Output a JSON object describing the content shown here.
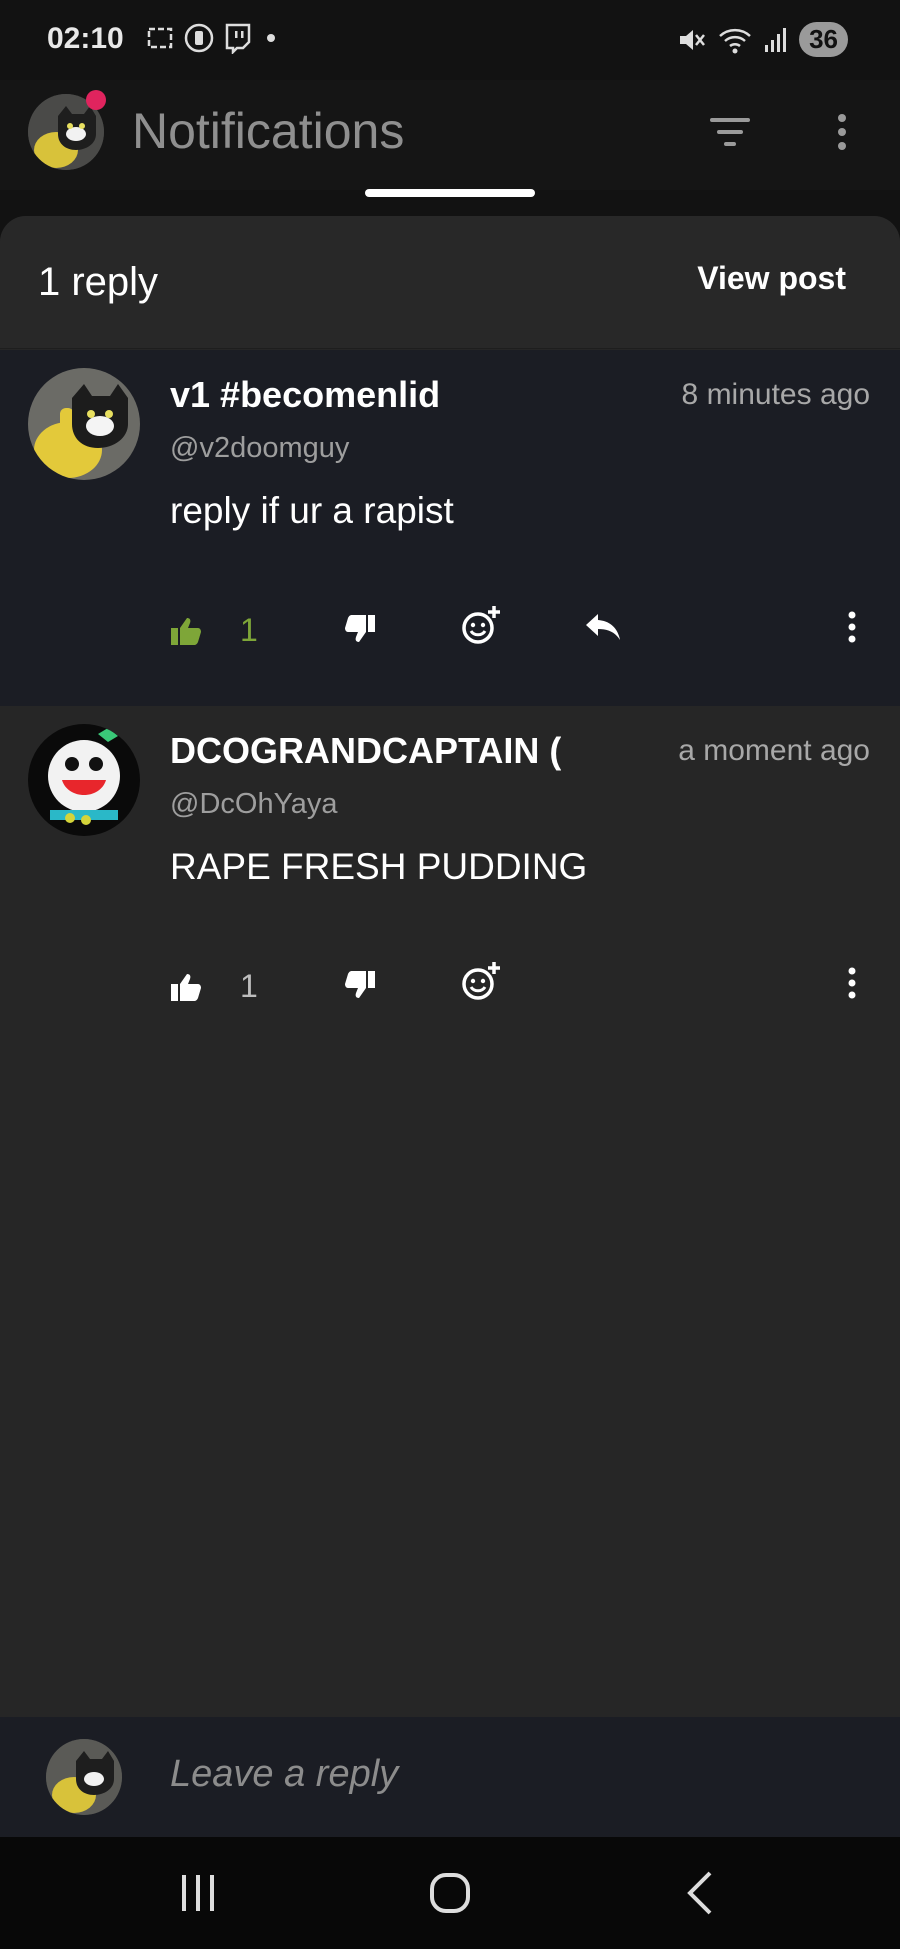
{
  "status_bar": {
    "time": "02:10",
    "battery": "36",
    "left_icons": [
      "screenshot-icon",
      "silent-icon",
      "twitch-icon",
      "dot-icon"
    ],
    "right_icons": [
      "muted-icon",
      "wifi-icon",
      "signal-icon"
    ]
  },
  "header": {
    "title": "Notifications",
    "icons": [
      "filter-icon",
      "more-vert-icon"
    ]
  },
  "sheet": {
    "reply_count": "1 reply",
    "view_post": "View post"
  },
  "comments": [
    {
      "name": "v1 #becomenlid",
      "handle": "@v2doomguy",
      "time": "8 minutes ago",
      "text": "reply if ur a rapist",
      "likes": "1",
      "liked": true,
      "has_reply": true
    },
    {
      "name": "DCOGRANDCAPTAIN (",
      "handle": "@DcOhYaya",
      "time": "a moment ago",
      "text": "RAPE FRESH PUDDING",
      "likes": "1",
      "liked": false,
      "has_reply": false
    }
  ],
  "composer": {
    "placeholder": "Leave a reply"
  },
  "colors": {
    "like_active": "#7ea638",
    "notification_dot": "#e0245e",
    "highlight_row": "#1b1d24"
  }
}
